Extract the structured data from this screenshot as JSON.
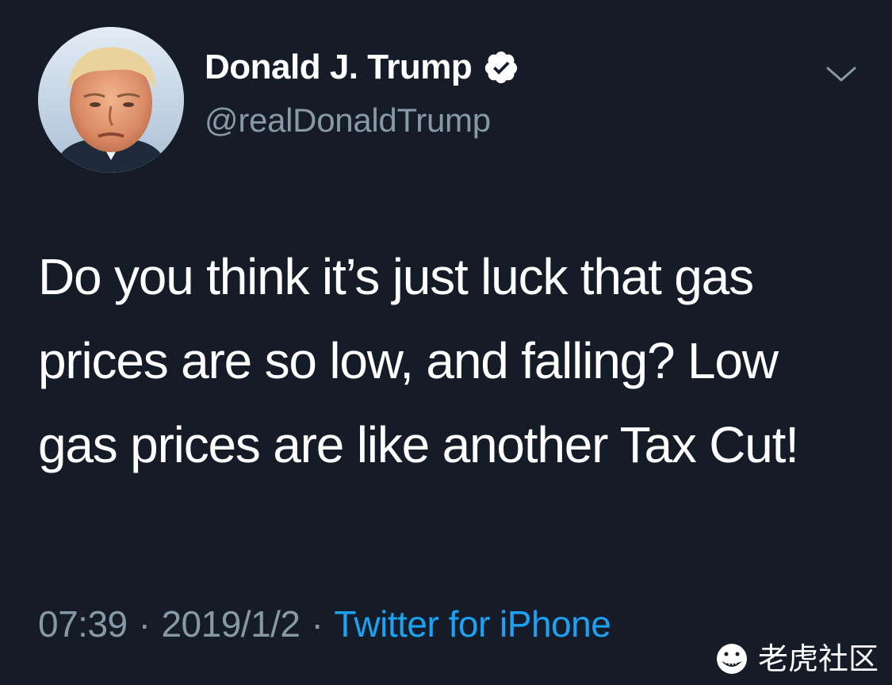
{
  "tweet": {
    "author": {
      "display_name": "Donald J. Trump",
      "handle": "@realDonaldTrump",
      "verified": true
    },
    "text": "Do you think it’s just luck that gas prices are so low, and falling? Low gas prices are like another Tax Cut!",
    "time": "07:39",
    "separator": "·",
    "date": "2019/1/2",
    "source": "Twitter for iPhone"
  },
  "icons": {
    "verified": "verified-badge-icon",
    "more": "chevron-down-icon",
    "watermark_logo": "tiger-logo-icon"
  },
  "watermark": {
    "text": "老虎社区"
  },
  "colors": {
    "background": "#151c28",
    "text": "#ffffff",
    "muted": "#8899a6",
    "link": "#1da1f2"
  }
}
